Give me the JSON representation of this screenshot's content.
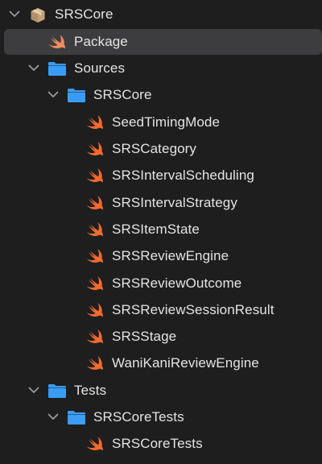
{
  "navigator": {
    "items": [
      {
        "label": "SRSCore",
        "icon": "package-icon",
        "expanded": true
      },
      {
        "label": "Package",
        "icon": "swift-file-icon",
        "selected": true
      },
      {
        "label": "Sources",
        "icon": "folder-icon",
        "expanded": true
      },
      {
        "label": "SRSCore",
        "icon": "folder-icon",
        "expanded": true
      },
      {
        "label": "SeedTimingMode",
        "icon": "swift-file-icon"
      },
      {
        "label": "SRSCategory",
        "icon": "swift-file-icon"
      },
      {
        "label": "SRSIntervalScheduling",
        "icon": "swift-file-icon"
      },
      {
        "label": "SRSIntervalStrategy",
        "icon": "swift-file-icon"
      },
      {
        "label": "SRSItemState",
        "icon": "swift-file-icon"
      },
      {
        "label": "SRSReviewEngine",
        "icon": "swift-file-icon"
      },
      {
        "label": "SRSReviewOutcome",
        "icon": "swift-file-icon"
      },
      {
        "label": "SRSReviewSessionResult",
        "icon": "swift-file-icon"
      },
      {
        "label": "SRSStage",
        "icon": "swift-file-icon"
      },
      {
        "label": "WaniKaniReviewEngine",
        "icon": "swift-file-icon"
      },
      {
        "label": "Tests",
        "icon": "folder-icon",
        "expanded": true
      },
      {
        "label": "SRSCoreTests",
        "icon": "folder-icon",
        "expanded": true
      },
      {
        "label": "SRSCoreTests",
        "icon": "swift-file-icon"
      }
    ]
  },
  "colors": {
    "background": "#1e1e1e",
    "selection": "#3d3d3f",
    "text": "#e4e4e4",
    "folder": "#3b9cf5",
    "swift": "#f26a2e",
    "package": "#c9a97a",
    "chevron": "#9a9a9a"
  }
}
